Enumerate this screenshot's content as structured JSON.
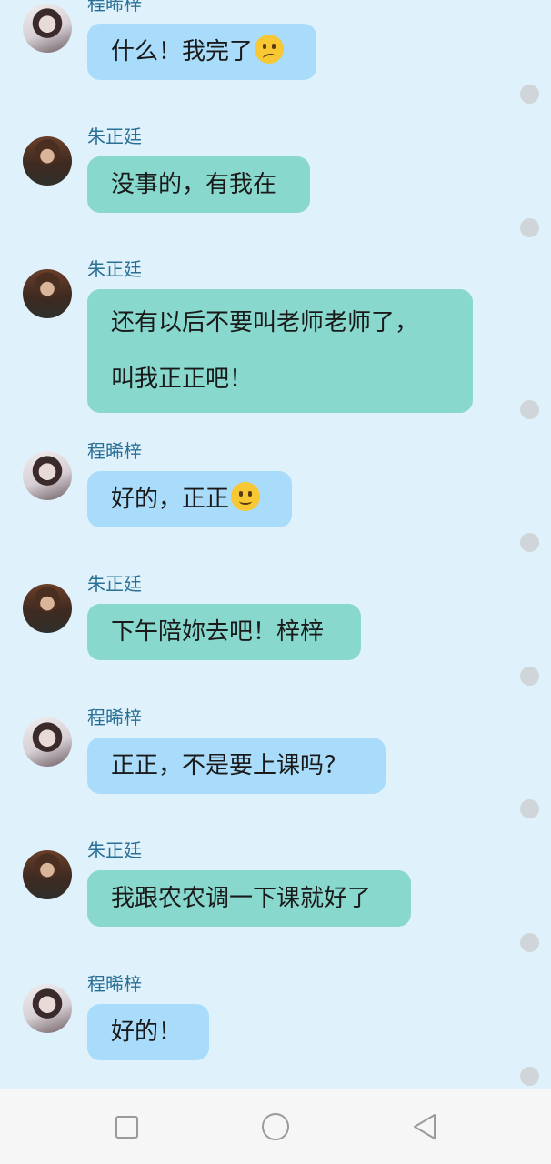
{
  "messages": [
    {
      "sender": "程晞梓",
      "side": "blue",
      "lines": [
        "什么！我完了"
      ],
      "emoji": "worried-face"
    },
    {
      "sender": "朱正廷",
      "side": "green",
      "lines": [
        "没事的，有我在"
      ]
    },
    {
      "sender": "朱正廷",
      "side": "green",
      "lines": [
        "还有以后不要叫老师老师了，",
        "叫我正正吧！"
      ]
    },
    {
      "sender": "程晞梓",
      "side": "blue",
      "lines": [
        "好的，正正"
      ],
      "emoji": "smiling-face"
    },
    {
      "sender": "朱正廷",
      "side": "green",
      "lines": [
        "下午陪妳去吧！梓梓"
      ]
    },
    {
      "sender": "程晞梓",
      "side": "blue",
      "lines": [
        "正正，不是要上课吗？"
      ]
    },
    {
      "sender": "朱正廷",
      "side": "green",
      "lines": [
        "我跟农农调一下课就好了"
      ]
    },
    {
      "sender": "程晞梓",
      "side": "blue",
      "lines": [
        "好的！"
      ]
    }
  ],
  "navbar": {
    "icons": [
      "recent-apps-icon",
      "home-icon",
      "back-icon"
    ]
  },
  "colors": {
    "background": "#dff1fb",
    "bubble_blue": "#a8dcfa",
    "bubble_green": "#88d8ce",
    "name_text": "#2a6f95"
  }
}
